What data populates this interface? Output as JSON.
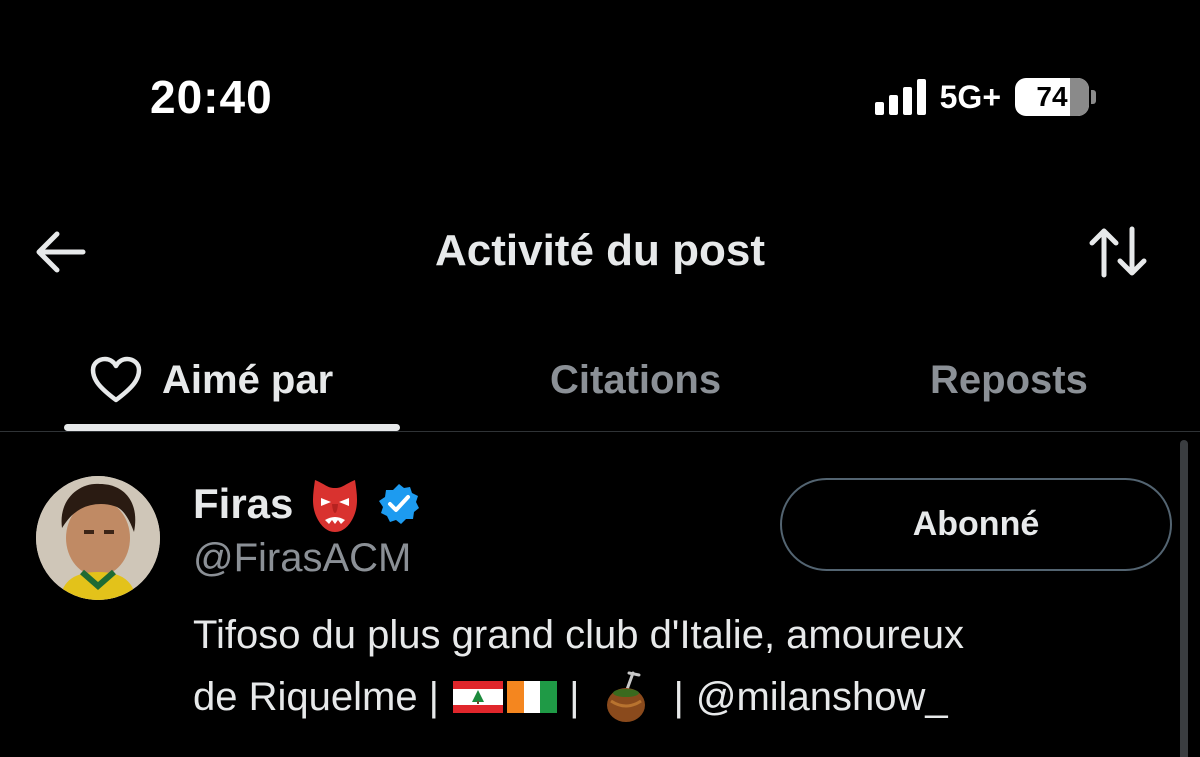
{
  "status_bar": {
    "time": "20:40",
    "network": "5G+",
    "battery_level": "74",
    "signal_bars": 4
  },
  "header": {
    "title": "Activité du post",
    "back_icon": "arrow-left-icon",
    "sort_icon": "sort-arrows-icon"
  },
  "tabs": [
    {
      "label": "Aimé par",
      "icon": "heart-icon",
      "active": true
    },
    {
      "label": "Citations",
      "active": false
    },
    {
      "label": "Reposts",
      "active": false
    }
  ],
  "user": {
    "name": "Firas",
    "handle": "@FirasACM",
    "verified": true,
    "follow_label": "Abonné",
    "bio_line1": "Tifoso du plus grand club d'Italie, amoureux",
    "bio_line2_start": "de Riquelme |",
    "bio_sep1": "|",
    "bio_sep2": "|",
    "bio_mention": "@milanshow_"
  },
  "colors": {
    "background": "#000000",
    "text_primary": "#e7e9ea",
    "text_secondary": "#8b9096",
    "verified_blue": "#1d9bf0",
    "divider": "#2f3336"
  }
}
